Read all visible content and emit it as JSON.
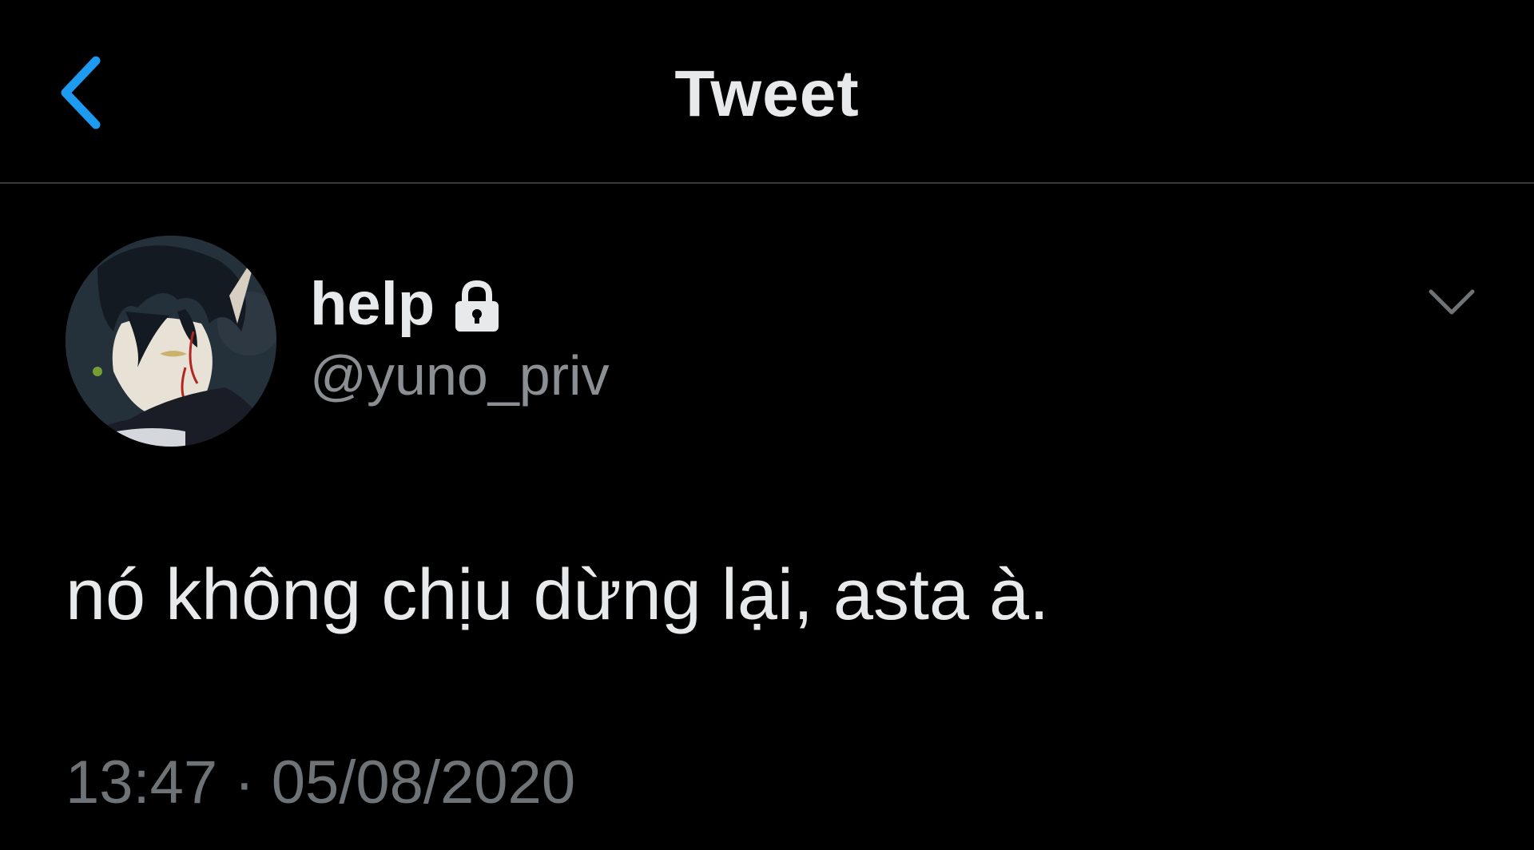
{
  "header": {
    "title": "Tweet",
    "back_icon": "chevron-left-icon",
    "accent_color": "#1d9bf0"
  },
  "author": {
    "display_name": "help",
    "handle": "@yuno_priv",
    "protected_icon": "lock-icon"
  },
  "tweet": {
    "text": "nó không chịu dừng lại, asta à.",
    "timestamp": "13:47 · 05/08/2020"
  },
  "menu": {
    "icon": "chevron-down-icon"
  },
  "colors": {
    "background": "#000000",
    "primary_text": "#e7e9ea",
    "secondary_text": "#8b8f94",
    "divider": "#3a3a3c"
  }
}
